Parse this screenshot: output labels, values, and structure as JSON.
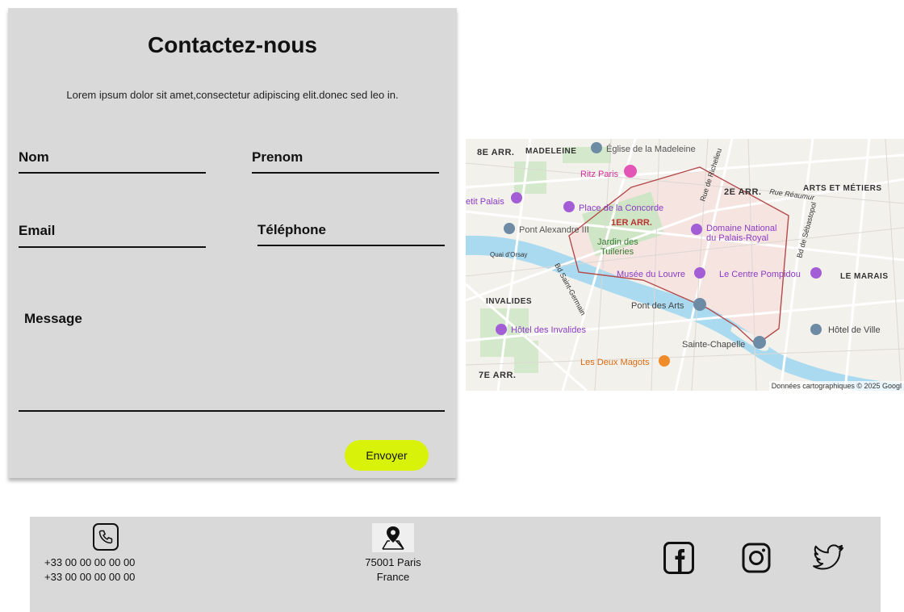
{
  "contact": {
    "title": "Contactez-nous",
    "subtitle": "Lorem ipsum dolor sit amet,consectetur adipiscing elit.donec sed leo in.",
    "fields": {
      "nom": "Nom",
      "prenom": "Prenom",
      "email": "Email",
      "telephone": "Téléphone",
      "message": "Message"
    },
    "submit_label": "Envoyer",
    "accent_color": "#d8f20a",
    "background_color": "#d9d9d9"
  },
  "map": {
    "labels": {
      "arr8": "8E ARR.",
      "madeleine": "MADELEINE",
      "eglise_madeleine": "Église de la Madeleine",
      "ritz": "Ritz Paris",
      "petit_palais": "etit Palais",
      "place_concorde": "Place de la Concorde",
      "arr1": "1ER ARR.",
      "arr2": "2E ARR.",
      "rue_reaumur": "Rue Réaumur",
      "arts_metiers": "ARTS ET MÉTIERS",
      "rue_richelieu": "Rue de Richelieu",
      "pont_alexandre": "Pont Alexandre III",
      "domaine_1": "Domaine National",
      "domaine_2": "du Palais-Royal",
      "bd_sebastopol": "Bd de Sébastopol",
      "quai_orsay": "Quai d'Orsay",
      "jardin_1": "Jardin des",
      "jardin_2": "Tuileries",
      "musee_louvre": "Musée du Louvre",
      "centre_pompidou": "Le Centre Pompidou",
      "le_marais": "LE MARAIS",
      "bd_saint_germain": "Bd Saint-Germain",
      "invalides": "INVALIDES",
      "pont_des_arts": "Pont des Arts",
      "hotel_invalides": "Hôtel des Invalides",
      "hotel_de_ville": "Hôtel de Ville",
      "sainte_chapelle": "Sainte-Chapelle",
      "deux_magots": "Les Deux Magots",
      "arr7": "7E ARR."
    },
    "credit": "Données cartographiques © 2025 Googl"
  },
  "footer": {
    "phones": [
      "+33 00 00 00 00 00",
      "+33 00 00 00 00 00"
    ],
    "address": [
      "75001 Paris",
      "France"
    ],
    "icons": {
      "phone": "phone-icon",
      "location": "map-pin-icon",
      "facebook": "facebook-icon",
      "instagram": "instagram-icon",
      "twitter": "twitter-icon"
    },
    "icon_color": "#111111"
  }
}
